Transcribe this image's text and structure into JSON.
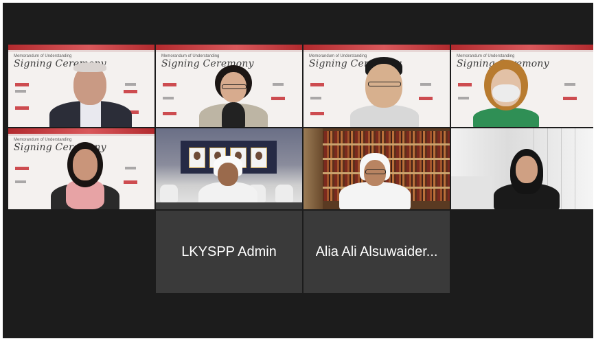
{
  "slide": {
    "subtitle": "Memorandum of Understanding",
    "title": "Signing Ceremony"
  },
  "participants": [
    {
      "name": "LKYSPP Admin"
    },
    {
      "name": "Alia Ali Alsuwaider..."
    }
  ],
  "colors": {
    "background": "#1c1c1c",
    "tile": "#3a3a3a",
    "active_speaker_border": "#e0c84a",
    "slide_accent": "#b22a2e"
  }
}
